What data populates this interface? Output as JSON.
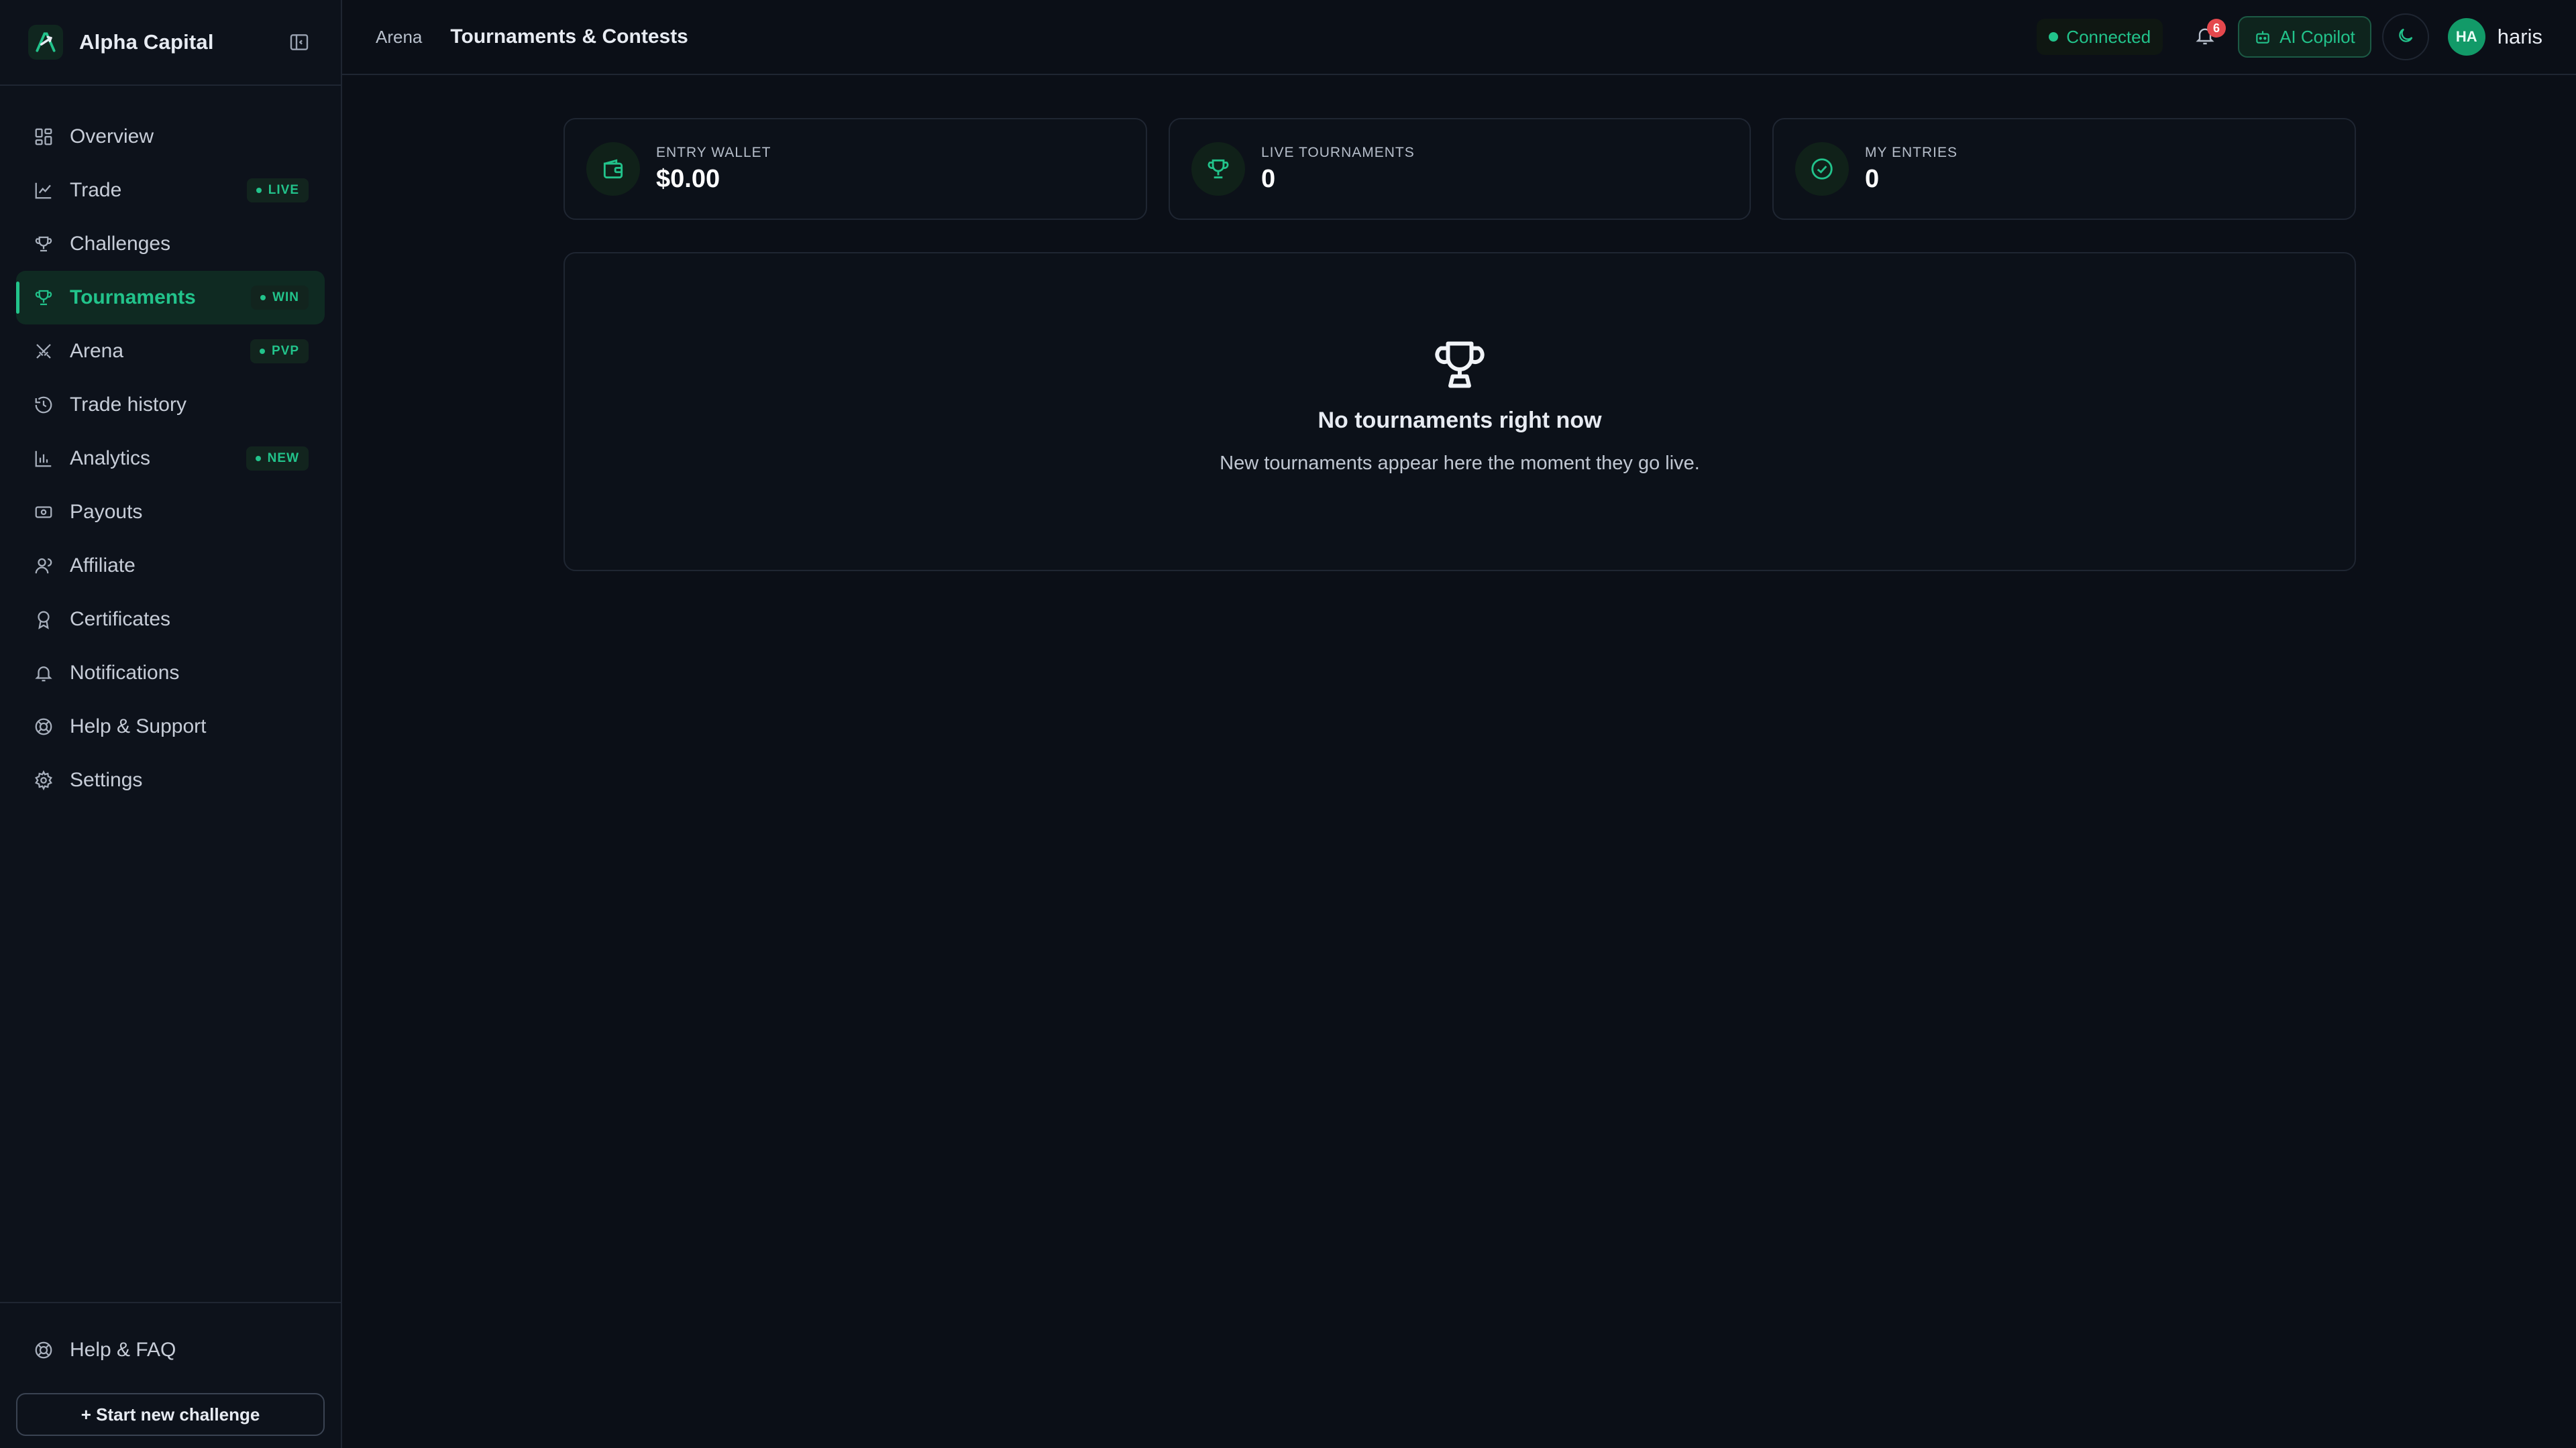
{
  "brand": {
    "name": "Alpha Capital"
  },
  "nav": [
    {
      "label": "Overview",
      "icon": "overview-icon"
    },
    {
      "label": "Trade",
      "icon": "chart-icon",
      "badge": "LIVE"
    },
    {
      "label": "Challenges",
      "icon": "trophy-icon"
    },
    {
      "label": "Tournaments",
      "icon": "trophy-icon",
      "badge": "WIN",
      "active": true
    },
    {
      "label": "Arena",
      "icon": "swords-icon",
      "badge": "PVP"
    },
    {
      "label": "Trade history",
      "icon": "history-icon"
    },
    {
      "label": "Analytics",
      "icon": "bar-chart-icon",
      "badge": "NEW"
    },
    {
      "label": "Payouts",
      "icon": "banknote-icon"
    },
    {
      "label": "Affiliate",
      "icon": "users-icon"
    },
    {
      "label": "Certificates",
      "icon": "award-icon"
    },
    {
      "label": "Notifications",
      "icon": "bell-icon"
    },
    {
      "label": "Help & Support",
      "icon": "lifebuoy-icon"
    },
    {
      "label": "Settings",
      "icon": "gear-icon"
    }
  ],
  "sidebar_bottom": {
    "help": "Help & FAQ",
    "start_button": "+ Start new challenge"
  },
  "header": {
    "breadcrumb": "Arena",
    "title": "Tournaments & Contests",
    "status": "Connected",
    "notifications_count": "6",
    "copilot": "AI Copilot",
    "avatar_initials": "HA",
    "username": "haris"
  },
  "stats": [
    {
      "label": "ENTRY WALLET",
      "value": "$0.00",
      "icon": "wallet-icon"
    },
    {
      "label": "LIVE TOURNAMENTS",
      "value": "0",
      "icon": "trophy-icon"
    },
    {
      "label": "MY ENTRIES",
      "value": "0",
      "icon": "check-circle-icon"
    }
  ],
  "empty_state": {
    "title": "No tournaments right now",
    "subtitle": "New tournaments appear here the moment they go live."
  },
  "colors": {
    "accent": "#22c38b",
    "background": "#0b0f17",
    "badge_red": "#e5484d"
  }
}
